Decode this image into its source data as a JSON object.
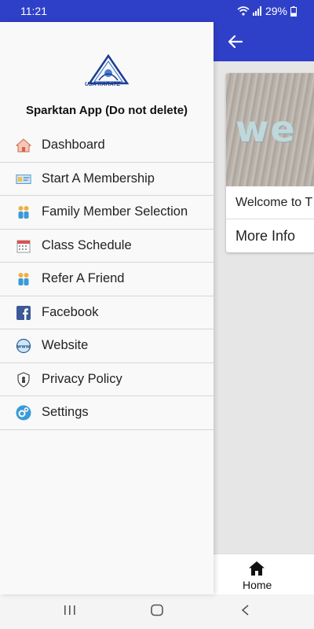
{
  "status_bar": {
    "time": "11:21",
    "battery": "29%"
  },
  "drawer": {
    "title": "Sparktan App (Do not delete)",
    "items": [
      {
        "label": "Dashboard",
        "icon": "home-icon"
      },
      {
        "label": "Start A Membership",
        "icon": "membership-card-icon"
      },
      {
        "label": "Family Member Selection",
        "icon": "family-icon"
      },
      {
        "label": "Class Schedule",
        "icon": "calendar-icon"
      },
      {
        "label": "Refer A Friend",
        "icon": "people-icon"
      },
      {
        "label": "Facebook",
        "icon": "facebook-icon"
      },
      {
        "label": "Website",
        "icon": "www-icon"
      },
      {
        "label": "Privacy Policy",
        "icon": "shield-icon"
      },
      {
        "label": "Settings",
        "icon": "gears-icon"
      }
    ]
  },
  "card": {
    "image_word": "we",
    "title": "Welcome to T",
    "more": "More Info"
  },
  "bottom_nav": {
    "home_label": "Home"
  },
  "colors": {
    "primary": "#2f40c8"
  }
}
